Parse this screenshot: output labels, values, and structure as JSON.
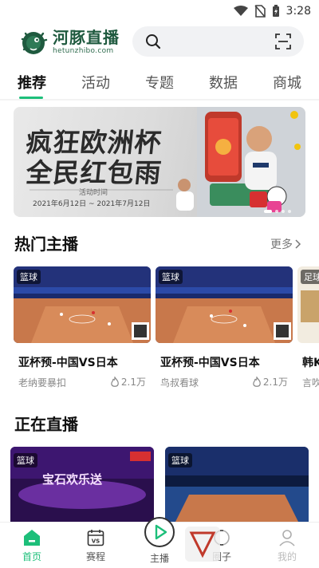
{
  "status_bar": {
    "time": "3:28"
  },
  "header": {
    "logo_name": "河豚直播",
    "logo_domain": "hetunzhibo.com"
  },
  "tabs": [
    {
      "label": "推荐",
      "active": true
    },
    {
      "label": "活动",
      "active": false
    },
    {
      "label": "专题",
      "active": false
    },
    {
      "label": "数据",
      "active": false
    },
    {
      "label": "商城",
      "active": false
    }
  ],
  "banner": {
    "title_line1": "疯狂欧洲杯",
    "title_line2": "全民红包雨",
    "subtitle": "活动时间",
    "date_range": "2021年6月12日 ~ 2021年7月12日"
  },
  "hot_section": {
    "title": "热门主播",
    "more_label": "更多"
  },
  "hot_cards": [
    {
      "tag": "篮球",
      "title": "亚杯预-中国VS日本",
      "host": "老纳要暴扣",
      "heat": "2.1万"
    },
    {
      "tag": "篮球",
      "title": "亚杯预-中国VS日本",
      "host": "鸟叔看球",
      "heat": "2.1万"
    },
    {
      "tag": "足球",
      "title": "韩K",
      "host": "言吹"
    }
  ],
  "live_section": {
    "title": "正在直播"
  },
  "live_cards": [
    {
      "tag": "篮球",
      "overlay_text": "宝石欢乐送"
    },
    {
      "tag": "篮球"
    }
  ],
  "bottom_nav": [
    {
      "label": "首页",
      "active": true
    },
    {
      "label": "赛程",
      "active": false
    },
    {
      "label": "主播",
      "active": false
    },
    {
      "label": "圈子",
      "active": false
    },
    {
      "label": "我的",
      "active": false
    }
  ],
  "colors": {
    "accent": "#1dbf7a",
    "brand_dark": "#1f5a3f"
  }
}
